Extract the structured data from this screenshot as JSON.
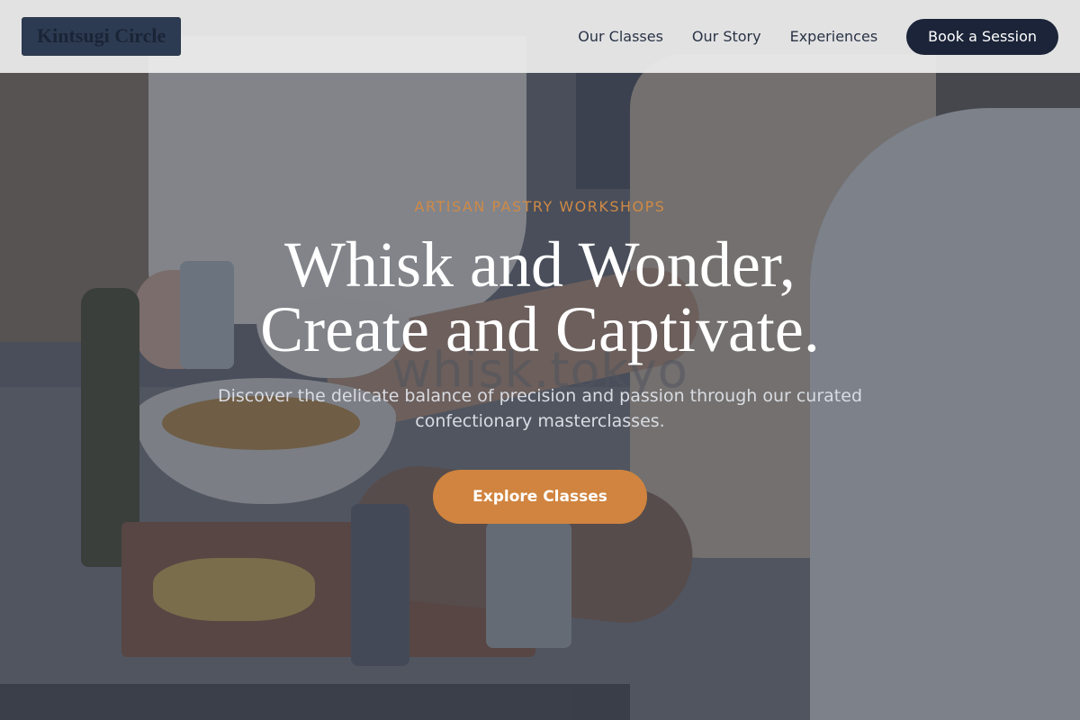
{
  "header": {
    "logo_text": "Kintsugi Circle",
    "nav": [
      "Our Classes",
      "Our Story",
      "Experiences"
    ],
    "cta_label": "Book a Session"
  },
  "hero": {
    "kicker": "ARTISAN PASTRY WORKSHOPS",
    "headline_line1": "Whisk and Wonder,",
    "headline_line2": "Create and Captivate.",
    "subtext": "Discover the delicate balance of precision and passion through our curated confectionary masterclasses.",
    "cta_label": "Explore Classes",
    "watermark_text": "whisk.tokyo"
  },
  "colors": {
    "accent": "#d0843f",
    "navy": "#1b2438",
    "header_bg": "#eeeeee"
  }
}
